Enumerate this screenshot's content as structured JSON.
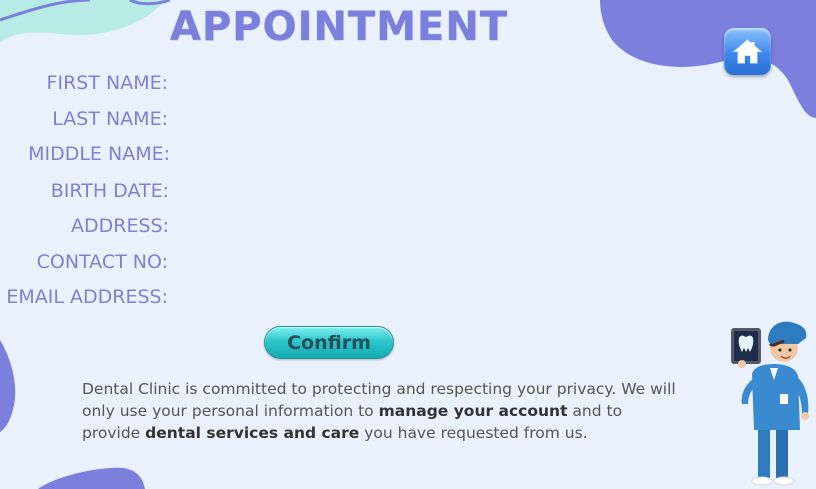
{
  "header": {
    "title": "APPOINTMENT"
  },
  "nav": {
    "home_icon": "home-icon"
  },
  "form": {
    "fields": [
      {
        "label": "FIRST NAME:",
        "value": ""
      },
      {
        "label": "LAST NAME:",
        "value": ""
      },
      {
        "label": "MIDDLE NAME:",
        "value": ""
      },
      {
        "label": "BIRTH DATE:",
        "value": ""
      },
      {
        "label": "ADDRESS:",
        "value": ""
      },
      {
        "label": "CONTACT NO:",
        "value": ""
      },
      {
        "label": "EMAIL ADDRESS:",
        "value": ""
      }
    ],
    "confirm_label": "Confirm"
  },
  "privacy": {
    "part1": "Dental Clinic is committed to protecting and respecting your privacy. We will only use your personal information to ",
    "bold1": "manage your account",
    "part2": " and to provide ",
    "bold2": "dental services and care",
    "part3": " you have requested from us."
  },
  "colors": {
    "background": "#e9f2fc",
    "accent_purple": "#7d7fdc",
    "label_purple": "#7f80cf",
    "mint": "#b7ece6",
    "confirm_teal": "#2ec6cb",
    "home_blue": "#3d86ec"
  }
}
